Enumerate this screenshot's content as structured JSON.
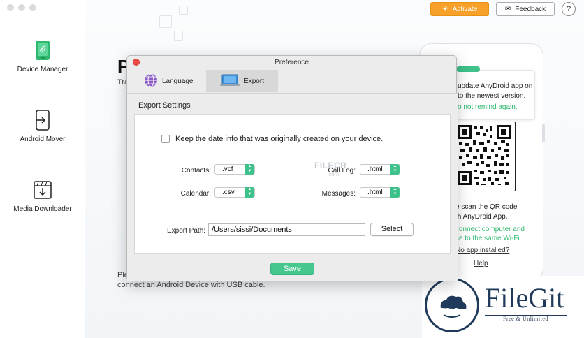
{
  "sidebar": {
    "items": [
      {
        "label": "Device Manager",
        "icon": "phone-icon",
        "color": "#2fb86f"
      },
      {
        "label": "Android Mover",
        "icon": "transfer-icon"
      },
      {
        "label": "Media Downloader",
        "icon": "download-icon"
      }
    ]
  },
  "toolbar": {
    "activate_label": "Activate",
    "feedback_label": "Feedback",
    "help_label": "?"
  },
  "main": {
    "title_partial": "P",
    "subtitle_partial": "Tra",
    "bottom_line1": "Ple",
    "bottom_line2": "connect an Android Device with USB cable."
  },
  "phone_panel": {
    "popup_line1": "update AnyDroid app on",
    "popup_line2": "to the newest version.",
    "popup_dismiss": "o not remind again.",
    "scan_line1": "e scan the QR code",
    "scan_line2": "th AnyDroid App.",
    "wifi_line1": "connect computer and",
    "wifi_line2": "ce to the same Wi-Fi.",
    "no_app_link": "No app installed?",
    "help_link": "Help"
  },
  "dialog": {
    "title": "Preference",
    "tabs": [
      {
        "label": "Language",
        "icon": "globe-icon"
      },
      {
        "label": "Export",
        "icon": "laptop-icon",
        "active": true
      }
    ],
    "section_title": "Export Settings",
    "keep_date_label": "Keep the date info that was originally created on your device.",
    "keep_date_checked": false,
    "fields": {
      "contacts": {
        "label": "Contacts:",
        "value": ".vcf"
      },
      "call_log": {
        "label": "Call Log:",
        "value": ".html"
      },
      "calendar": {
        "label": "Calendar:",
        "value": ".csv"
      },
      "messages": {
        "label": "Messages:",
        "value": ".html"
      }
    },
    "export_path_label": "Export Path:",
    "export_path_value": "/Users/sissi/Documents",
    "select_label": "Select",
    "save_label": "Save"
  },
  "watermarks": {
    "filecr": "FILECR",
    "filecr_com": ".com",
    "filegit_name": "FileGit",
    "filegit_tagline": "Free & Unlimited"
  },
  "colors": {
    "accent_green": "#3ec18a",
    "activate_orange": "#f7a12a",
    "close_red": "#ee4d46",
    "filegit_navy": "#1f3a5a"
  }
}
